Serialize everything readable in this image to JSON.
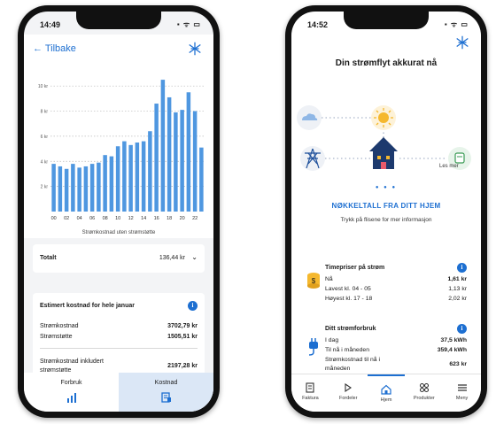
{
  "left": {
    "status": {
      "time": "14:49",
      "icons": "▪ ᯤ ▭"
    },
    "topbar": {
      "back_label": "← Tilbake"
    },
    "chart_data": {
      "type": "bar",
      "x": [
        "00",
        "01",
        "02",
        "03",
        "04",
        "05",
        "06",
        "07",
        "08",
        "09",
        "10",
        "11",
        "12",
        "13",
        "14",
        "15",
        "16",
        "17",
        "18",
        "19",
        "20",
        "21",
        "22",
        "23"
      ],
      "values": [
        3.8,
        3.6,
        3.4,
        3.8,
        3.5,
        3.6,
        3.8,
        3.9,
        4.5,
        4.4,
        5.2,
        5.6,
        5.3,
        5.5,
        5.6,
        6.4,
        8.6,
        10.5,
        9.1,
        7.9,
        8.1,
        9.5,
        8.0,
        5.1
      ],
      "ytick_labels": [
        "2 kr",
        "4 kr",
        "6 kr",
        "8 kr",
        "10 kr"
      ],
      "yticks": [
        2,
        4,
        6,
        8,
        10
      ],
      "xtick_labels": [
        "00",
        "02",
        "04",
        "06",
        "08",
        "10",
        "12",
        "14",
        "16",
        "18",
        "20",
        "22"
      ],
      "ylim": [
        0,
        11
      ],
      "xlabel": "Strømkostnad uten strømstøtte",
      "bar_color": "#4f97e0",
      "grid": true
    },
    "totals": {
      "label": "Totalt",
      "value": "136,44 kr",
      "chevron": "⌄"
    },
    "estimate": {
      "title": "Estimert kostnad for hele januar",
      "info": "i",
      "rows": [
        {
          "k": "Strømkostnad",
          "v": "3702,79 kr"
        },
        {
          "k": "Strømstøtte",
          "v": "1505,51 kr"
        }
      ],
      "total_k1": "Strømkostnad inkludert",
      "total_k2": "strømstøtte",
      "total_v": "2197,28 kr"
    },
    "tabs": [
      {
        "label": "Forbruk",
        "icon": "bar-chart-icon"
      },
      {
        "label": "Kostnad",
        "icon": "invoice-icon"
      }
    ]
  },
  "right": {
    "status": {
      "time": "14:52",
      "icons": "▪ ᯤ ▭"
    },
    "headline": "Din strømflyt akkurat nå",
    "les_mer": "Les mer",
    "pager_dots": "● ● ●",
    "key_heading": "NØKKELTALL FRA DITT HJEM",
    "key_sub": "Trykk på flisene for mer informasjon",
    "prices": {
      "title": "Timepriser på strøm",
      "rows": [
        {
          "k": "Nå",
          "v": "1,61 kr"
        },
        {
          "k": "Lavest kl. 04 - 05",
          "v": "1,13 kr"
        },
        {
          "k": "Høyest kl. 17 - 18",
          "v": "2,02 kr"
        }
      ]
    },
    "usage": {
      "title": "Ditt strømforbruk",
      "rows": [
        {
          "k": "I dag",
          "v": "37,5 kWh"
        },
        {
          "k": "Til nå i måneden",
          "v": "359,4 kWh"
        },
        {
          "k": "Strømkostnad til nå i",
          "v": "623 kr"
        },
        {
          "k": "måneden",
          "v": ""
        }
      ]
    },
    "nav": [
      {
        "label": "Faktura",
        "icon": "invoice-icon"
      },
      {
        "label": "Fordeler",
        "icon": "gift-icon"
      },
      {
        "label": "Hjem",
        "icon": "home-icon"
      },
      {
        "label": "Produkter",
        "icon": "grid-icon"
      },
      {
        "label": "Meny",
        "icon": "menu-icon"
      }
    ],
    "accent": "#1d6fd1"
  }
}
